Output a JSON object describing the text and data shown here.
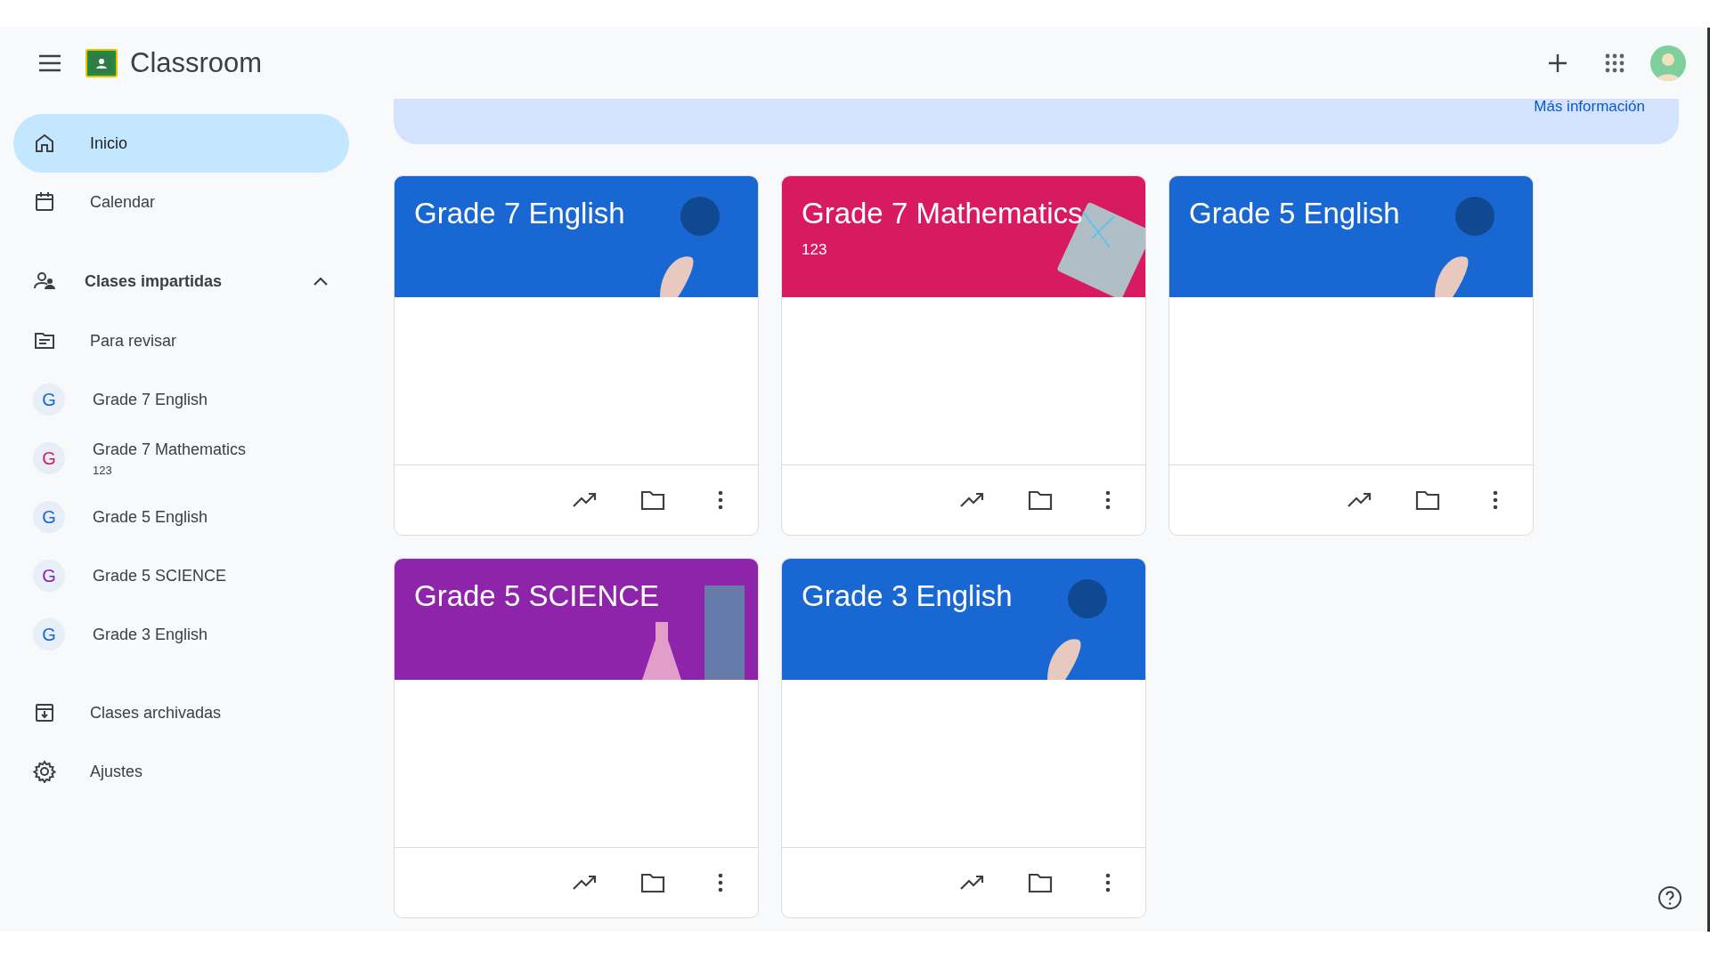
{
  "app_bar": {
    "title": "Classroom"
  },
  "sidebar": {
    "items": [
      {
        "kind": "link",
        "label": "Inicio",
        "selected": true
      },
      {
        "kind": "link",
        "label": "Calendar",
        "selected": false
      },
      {
        "kind": "section",
        "label": "Clases impartidas",
        "expanded": true
      },
      {
        "kind": "link",
        "label": "Para revisar",
        "selected": false
      },
      {
        "kind": "class",
        "letter": "G",
        "label": "Grade 7 English",
        "color": "#1967d2",
        "selected": false
      },
      {
        "kind": "class",
        "letter": "G",
        "label": "Grade 7 Mathematics",
        "subtitle": "123",
        "color": "#d81b60",
        "selected": false
      },
      {
        "kind": "class",
        "letter": "G",
        "label": "Grade 5 English",
        "color": "#1967d2",
        "selected": false
      },
      {
        "kind": "class",
        "letter": "G",
        "label": "Grade 5 SCIENCE",
        "color": "#8e24aa",
        "selected": false
      },
      {
        "kind": "class",
        "letter": "G",
        "label": "Grade 3 English",
        "color": "#1967d2",
        "selected": false
      },
      {
        "kind": "divider"
      },
      {
        "kind": "link",
        "label": "Clases archivadas",
        "selected": false
      },
      {
        "kind": "link",
        "label": "Ajustes",
        "selected": false
      }
    ]
  },
  "banner": {
    "link": "Más información"
  },
  "cards": [
    {
      "title": "Grade 7 English",
      "color": "#1967d2"
    },
    {
      "title": "Grade 7 Mathematics",
      "subtitle": "123",
      "color": "#d81b60"
    },
    {
      "title": "Grade 5 English",
      "color": "#1967d2"
    },
    {
      "title": "Grade 5 SCIENCE",
      "color": "#8e24aa"
    },
    {
      "title": "Grade 3 English",
      "color": "#1967d2"
    }
  ]
}
